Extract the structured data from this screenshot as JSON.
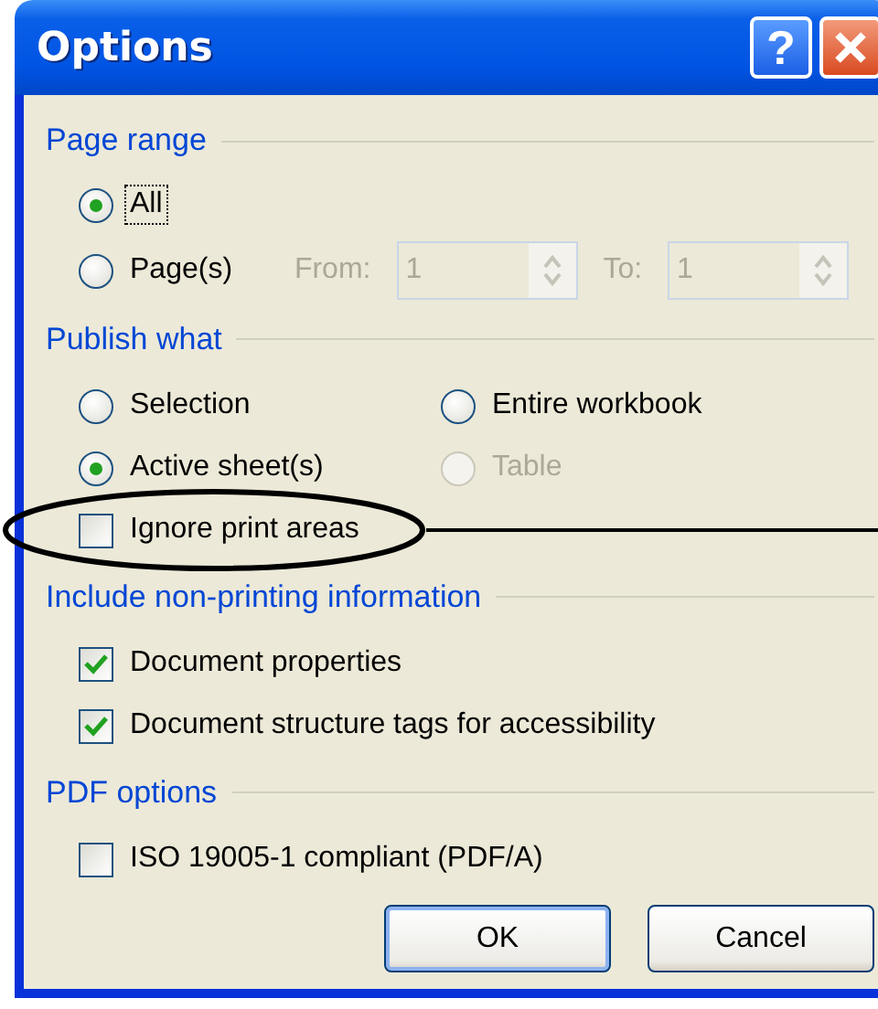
{
  "window": {
    "title": "Options"
  },
  "title_buttons": [
    {
      "kind": "help",
      "label": "?"
    },
    {
      "kind": "close"
    }
  ],
  "sections": [
    {
      "title": "Page range",
      "rows": [
        [
          {
            "kind": "radio",
            "label": "All",
            "selected": true,
            "focused": true
          }
        ],
        [
          {
            "kind": "radio",
            "label": "Page(s)",
            "selected": false
          },
          {
            "kind": "spin_field",
            "label": "From:",
            "value": "1",
            "disabled": true
          },
          {
            "kind": "spin_field",
            "label": "To:",
            "value": "1",
            "disabled": true
          }
        ]
      ]
    },
    {
      "title": "Publish what",
      "rows": [
        [
          {
            "kind": "radio",
            "label": "Selection",
            "selected": false
          },
          {
            "kind": "radio",
            "label": "Entire workbook",
            "selected": false
          }
        ],
        [
          {
            "kind": "radio",
            "label": "Active sheet(s)",
            "selected": true
          },
          {
            "kind": "radio",
            "label": "Table",
            "selected": false,
            "disabled": true
          }
        ],
        [
          {
            "kind": "checkbox",
            "label": "Ignore print areas",
            "checked": false,
            "circled": true
          }
        ]
      ]
    },
    {
      "title": "Include non-printing information",
      "rows": [
        [
          {
            "kind": "checkbox",
            "label": "Document properties",
            "checked": true
          }
        ],
        [
          {
            "kind": "checkbox",
            "label": "Document structure tags for accessibility",
            "checked": true
          }
        ]
      ]
    },
    {
      "title": "PDF options",
      "rows": [
        [
          {
            "kind": "checkbox",
            "label": "ISO 19005-1 compliant (PDF/A)",
            "checked": false
          }
        ]
      ]
    }
  ],
  "buttons": [
    {
      "label": "OK",
      "default": true
    },
    {
      "label": "Cancel",
      "default": false
    }
  ]
}
